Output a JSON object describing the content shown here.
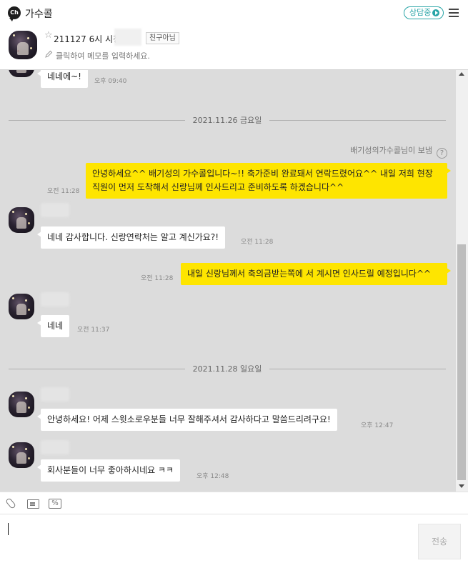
{
  "header": {
    "logo_text": "Ch",
    "title": "가수콜",
    "status_label": "상담중",
    "status_color": "#2aa5a7",
    "menu_icon": "hamburger-icon"
  },
  "profile": {
    "star_icon": "☆",
    "name": "211127 6시 시청",
    "friend_badge": "친구아님",
    "memo_placeholder": "클릭하여 메모를 입력하세요."
  },
  "chat": {
    "background_color": "#dcdcdc",
    "my_bubble_color": "#fee500",
    "messages_top": {
      "text": "네네에~!",
      "time": "오후 09:40"
    },
    "date_1": "2021.11.26 금요일",
    "sent_by_note": "배기성의가수콜님이 보냄",
    "help_icon": "?",
    "msg_out_1": {
      "text": "안녕하세요^^ 배기성의 가수콜입니다~!! 축가준비 완료돼서 연락드렸어요^^ 내일 저희 현장 직원이 먼저 도착해서 신랑님께 인사드리고 준비하도록 하겠습니다^^",
      "time": "오전 11:28"
    },
    "msg_in_1": {
      "text": "네네 감사합니다. 신랑연락처는 알고 계신가요?!",
      "time": "오전 11:28"
    },
    "msg_out_2": {
      "text": "내일 신랑님께서 축의금받는쪽에 서 계시면 인사드릴 예정입니다^^",
      "time": "오전 11:28"
    },
    "msg_in_2": {
      "text": "네네",
      "time": "오전 11:37"
    },
    "date_2": "2021.11.28 일요일",
    "msg_in_3": {
      "text": "안녕하세요! 어제 스윗소로우분들 너무 잘해주셔서 감사하다고 말씀드리려구요!",
      "time": "오후 12:47"
    },
    "msg_in_4": {
      "text": "회사분들이 너무 좋아하시네요 ㅋㅋ",
      "time": "오후 12:48"
    }
  },
  "composer": {
    "tools": [
      "paperclip-icon",
      "template-icon",
      "percent-icon"
    ],
    "percent_label": "%",
    "send_label": "전송"
  }
}
